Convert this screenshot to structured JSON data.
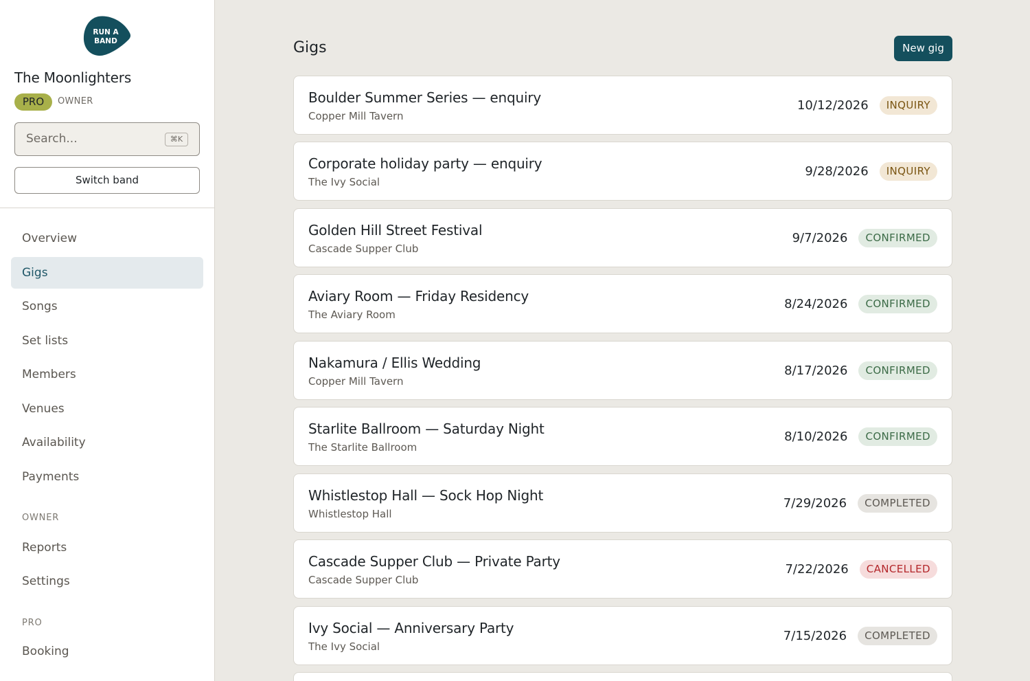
{
  "sidebar": {
    "logo_line1": "RUN A",
    "logo_line2": "BAND",
    "band_name": "The Moonlighters",
    "plan_badge": "PRO",
    "role": "OWNER",
    "search_placeholder": "Search...",
    "search_shortcut": "⌘K",
    "switch_band": "Switch band",
    "nav": [
      {
        "label": "Overview",
        "active": false
      },
      {
        "label": "Gigs",
        "active": true
      },
      {
        "label": "Songs",
        "active": false
      },
      {
        "label": "Set lists",
        "active": false
      },
      {
        "label": "Members",
        "active": false
      },
      {
        "label": "Venues",
        "active": false
      },
      {
        "label": "Availability",
        "active": false
      },
      {
        "label": "Payments",
        "active": false
      }
    ],
    "owner_section_label": "OWNER",
    "owner_nav": [
      {
        "label": "Reports"
      },
      {
        "label": "Settings"
      }
    ],
    "pro_section_label": "PRO",
    "pro_nav": [
      {
        "label": "Booking"
      }
    ]
  },
  "main": {
    "title": "Gigs",
    "new_button": "New gig",
    "gigs": [
      {
        "title": "Boulder Summer Series — enquiry",
        "venue": "Copper Mill Tavern",
        "date": "10/12/2026",
        "status": "INQUIRY",
        "kind": "inquiry"
      },
      {
        "title": "Corporate holiday party — enquiry",
        "venue": "The Ivy Social",
        "date": "9/28/2026",
        "status": "INQUIRY",
        "kind": "inquiry"
      },
      {
        "title": "Golden Hill Street Festival",
        "venue": "Cascade Supper Club",
        "date": "9/7/2026",
        "status": "CONFIRMED",
        "kind": "confirmed"
      },
      {
        "title": "Aviary Room — Friday Residency",
        "venue": "The Aviary Room",
        "date": "8/24/2026",
        "status": "CONFIRMED",
        "kind": "confirmed"
      },
      {
        "title": "Nakamura / Ellis Wedding",
        "venue": "Copper Mill Tavern",
        "date": "8/17/2026",
        "status": "CONFIRMED",
        "kind": "confirmed"
      },
      {
        "title": "Starlite Ballroom — Saturday Night",
        "venue": "The Starlite Ballroom",
        "date": "8/10/2026",
        "status": "CONFIRMED",
        "kind": "confirmed"
      },
      {
        "title": "Whistlestop Hall — Sock Hop Night",
        "venue": "Whistlestop Hall",
        "date": "7/29/2026",
        "status": "COMPLETED",
        "kind": "completed"
      },
      {
        "title": "Cascade Supper Club — Private Party",
        "venue": "Cascade Supper Club",
        "date": "7/22/2026",
        "status": "CANCELLED",
        "kind": "cancelled"
      },
      {
        "title": "Ivy Social — Anniversary Party",
        "venue": "The Ivy Social",
        "date": "7/15/2026",
        "status": "COMPLETED",
        "kind": "completed"
      }
    ]
  },
  "colors": {
    "brand": "#144f5d",
    "pro_badge": "#a8b04a",
    "background": "#ebe9e4"
  }
}
